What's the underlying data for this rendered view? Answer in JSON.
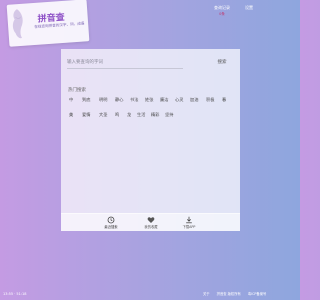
{
  "logo": {
    "title": "拼音查",
    "subtitle": "在线查询拼音的汉字、词、成语"
  },
  "top": {
    "records_label": "查询记录",
    "records_count": "0条",
    "settings_label": "设置"
  },
  "search": {
    "placeholder": "输入要查询的字词",
    "button_label": "搜索"
  },
  "hot": {
    "title": "热门搜索",
    "row1": [
      "中",
      "到底",
      "明明",
      "静心",
      "书法",
      "姓张",
      "廉洁",
      "心灵",
      "加油",
      "积极",
      "春"
    ],
    "row2": [
      "美",
      "爱情",
      "大圣",
      "鸣",
      "龙",
      "生活",
      "精彩",
      "坚持"
    ]
  },
  "toolbar": {
    "items": [
      {
        "label": "最近搜索",
        "icon": "clock-icon"
      },
      {
        "label": "我的收藏",
        "icon": "heart-icon"
      },
      {
        "label": "下载APP",
        "icon": "download-icon"
      }
    ]
  },
  "footer": {
    "left": "13:55 · 51:18",
    "about": "关于",
    "copyright": "拼音查 版权所有",
    "icp": "粤ICP备案号"
  }
}
